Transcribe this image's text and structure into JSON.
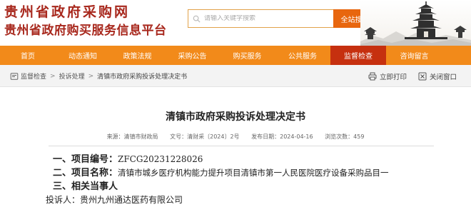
{
  "header": {
    "title": "贵州省政府采购网",
    "subtitle": "贵州省政府购买服务信息平台"
  },
  "search": {
    "placeholder": "请输入关键字搜索",
    "button_label": "全站搜索"
  },
  "nav": {
    "items": [
      {
        "label": "首页"
      },
      {
        "label": "动态通知"
      },
      {
        "label": "政策法规"
      },
      {
        "label": "采购公告"
      },
      {
        "label": "购买服务"
      },
      {
        "label": "公共服务"
      },
      {
        "label": "监督检查",
        "active": true
      },
      {
        "label": "咨询留言"
      }
    ]
  },
  "breadcrumb": {
    "items": [
      "监督检查",
      "投诉处理",
      "清镇市政府采购投诉处理决定书"
    ]
  },
  "actions": {
    "print": "立即打印",
    "close": "关闭窗口"
  },
  "doc": {
    "title": "清镇市政府采购投诉处理决定书",
    "source": "来源：清镇市财政局",
    "doc_no": "文号：清财采〔2024〕2号",
    "date": "发布日期：2024-04-16",
    "views": "浏览次数：459",
    "lines": [
      {
        "label": "一、项目编号：",
        "text": "ZFCG20231228026"
      },
      {
        "label": "二、项目名称：",
        "text": "清镇市城乡医疗机构能力提升项目清镇市第一人民医院医疗设备采购品目一"
      },
      {
        "label": "三、相关当事人",
        "text": ""
      },
      {
        "label": "",
        "text": "投诉人：贵州九州通达医药有限公司"
      }
    ]
  },
  "colors": {
    "brand_red": "#a8281d",
    "nav_orange": "#f28a1a",
    "nav_active": "#c6300f",
    "search_button": "#e8660e"
  }
}
